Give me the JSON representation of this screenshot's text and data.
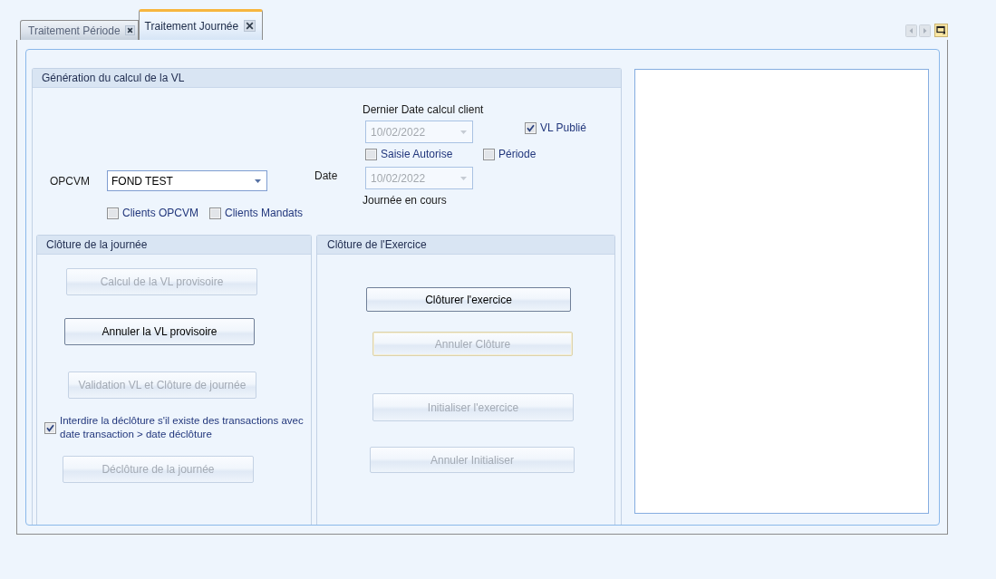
{
  "tabs": [
    {
      "label": "Traitement Période",
      "selected": false
    },
    {
      "label": "Traitement Journée",
      "selected": true
    }
  ],
  "generation": {
    "title": "Génération du calcul de la VL",
    "opcvm": {
      "label": "OPCVM",
      "value": "FOND TEST"
    },
    "client_filters": [
      {
        "label": "Clients OPCVM",
        "checked": false
      },
      {
        "label": "Clients Mandats",
        "checked": false
      }
    ],
    "date_label": "Date",
    "last_calc_date": {
      "label": "Dernier Date calcul client",
      "value": "10/02/2022",
      "disabled": true
    },
    "saisie_autorise": {
      "label": "Saisie Autorise",
      "checked": false
    },
    "date": {
      "value": "10/02/2022",
      "disabled": true,
      "caption": "Journée en cours"
    },
    "vl_publie": {
      "label": "VL Publié",
      "checked": true
    },
    "periode": {
      "label": "Période",
      "checked": false
    }
  },
  "day_closing": {
    "title": "Clôture de la journée",
    "items": [
      {
        "kind": "button",
        "label": "Calcul de la VL provisoire",
        "disabled": true,
        "focused": false
      },
      {
        "kind": "button",
        "label": "Annuler la VL provisoire",
        "disabled": false,
        "focused": false
      },
      {
        "kind": "button",
        "label": "Validation VL et Clôture de journée",
        "disabled": true,
        "focused": false
      },
      {
        "kind": "checkbox",
        "label": "Interdire la déclôture s'il existe des transactions avec date transaction > date déclôture",
        "checked": true
      },
      {
        "kind": "button",
        "label": "Déclôture de la journée",
        "disabled": true,
        "focused": false
      }
    ]
  },
  "year_closing": {
    "title": "Clôture de l'Exercice",
    "buttons": [
      {
        "label": "Clôturer l'exercice",
        "disabled": false,
        "focused": false
      },
      {
        "label": "Annuler Clôture",
        "disabled": true,
        "focused": true
      },
      {
        "label": "Initialiser l'exercice",
        "disabled": true,
        "focused": false
      },
      {
        "label": "Annuler Initialiser",
        "disabled": true,
        "focused": false
      }
    ]
  }
}
